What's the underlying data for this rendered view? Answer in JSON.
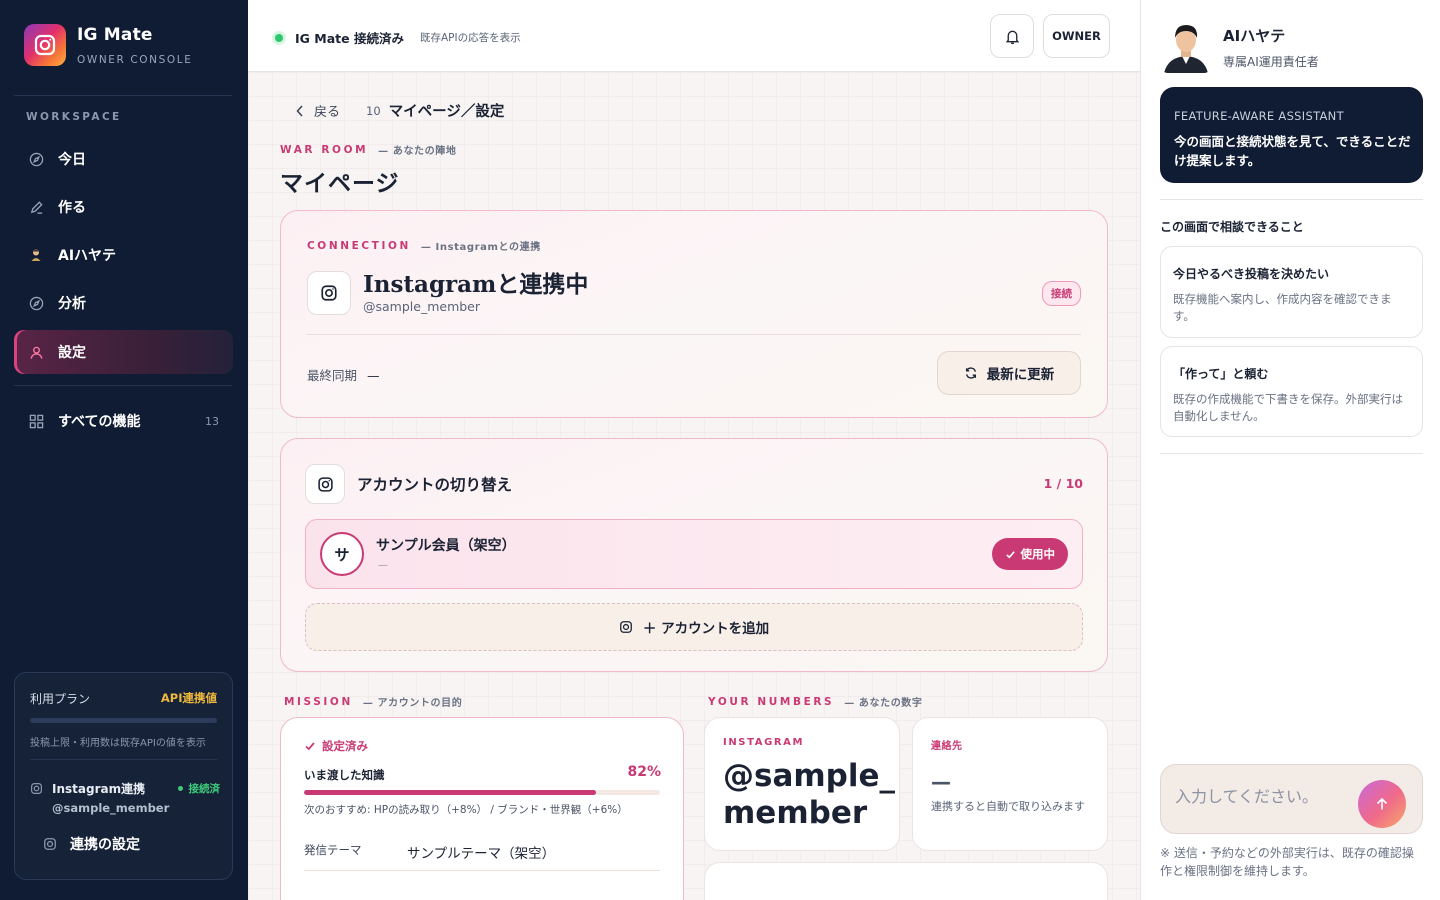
{
  "brand": {
    "name": "IG Mate",
    "subtitle": "OWNER CONSOLE"
  },
  "sidebar": {
    "section_label": "WORKSPACE",
    "items": [
      {
        "label": "今日",
        "icon": "compass-icon"
      },
      {
        "label": "作る",
        "icon": "pen-icon"
      },
      {
        "label": "AIハヤテ",
        "icon": "ai-avatar-icon"
      },
      {
        "label": "分析",
        "icon": "compass-icon"
      },
      {
        "label": "設定",
        "icon": "user-icon",
        "active": true
      }
    ],
    "all_features": {
      "label": "すべての機能",
      "count": "13",
      "icon": "grid-icon"
    },
    "plan": {
      "title": "利用プラン",
      "badge": "API連携値",
      "note": "投稿上限・利用数は既存APIの値を表示",
      "instagram_label": "Instagram連携",
      "instagram_status": "接続済",
      "instagram_handle": "@sample_member",
      "settings_link": "連携の設定"
    }
  },
  "topbar": {
    "status_text": "IG Mate 接続済み",
    "status_note": "既存APIの応答を表示",
    "owner_label": "OWNER",
    "status_color": "#2ec76b"
  },
  "main": {
    "back_label": "戻る",
    "page_number": "10",
    "breadcrumb_title": "マイページ／設定",
    "war_room": {
      "eyebrow": "WAR ROOM",
      "sub": "— あなたの陣地"
    },
    "page_title": "マイページ",
    "connection": {
      "eyebrow": "CONNECTION",
      "sub": "— Instagramとの連携",
      "title": "Instagramと連携中",
      "handle": "@sample_member",
      "badge": "接続",
      "sync_label": "最終同期",
      "sync_value": "—",
      "refresh_label": "最新に更新"
    },
    "account_switch": {
      "title": "アカウントの切り替え",
      "count": "1 / 10",
      "account": {
        "avatar_char": "サ",
        "name": "サンプル会員（架空）",
        "sub": "—",
        "badge": "使用中"
      },
      "add_label": "＋ アカウントを追加"
    },
    "mission": {
      "eyebrow": "MISSION",
      "sub": "— アカウントの目的",
      "done_label": "設定済み",
      "knowledge_label": "いま渡した知識",
      "knowledge_pct": "82%",
      "knowledge_value": 0.82,
      "recommend": "次のおすすめ: HPの読み取り（+8%） / ブランド・世界観（+6%）",
      "theme_label": "発信テーマ",
      "theme_value": "サンプルテーマ（架空）"
    },
    "numbers": {
      "eyebrow": "YOUR NUMBERS",
      "sub": "— あなたの数字",
      "instagram_label": "INSTAGRAM",
      "instagram_value": "@sample_member",
      "contact_label": "連絡先",
      "contact_value": "—",
      "contact_note": "連携すると自動で取り込みます"
    }
  },
  "assistant": {
    "name": "AIハヤテ",
    "role": "専属AI運用責任者",
    "card_title": "FEATURE-AWARE ASSISTANT",
    "card_desc": "今の画面と接続状態を見て、できることだけ提案します。",
    "heading": "この画面で相談できること",
    "suggestions": [
      {
        "title": "今日やるべき投稿を決めたい",
        "desc": "既存機能へ案内し、作成内容を確認できます。"
      },
      {
        "title": "「作って」と頼む",
        "desc": "既存の作成機能で下書きを保存。外部実行は自動化しません。"
      }
    ],
    "input_placeholder": "入力してください。",
    "footnote": "※ 送信・予約などの外部実行は、既存の確認操作と権限制御を維持します。"
  },
  "colors": {
    "accent": "#c93a74",
    "sidebar_bg": "#101c33",
    "success": "#3ecb7a",
    "plan_badge": "#f0b93c"
  }
}
